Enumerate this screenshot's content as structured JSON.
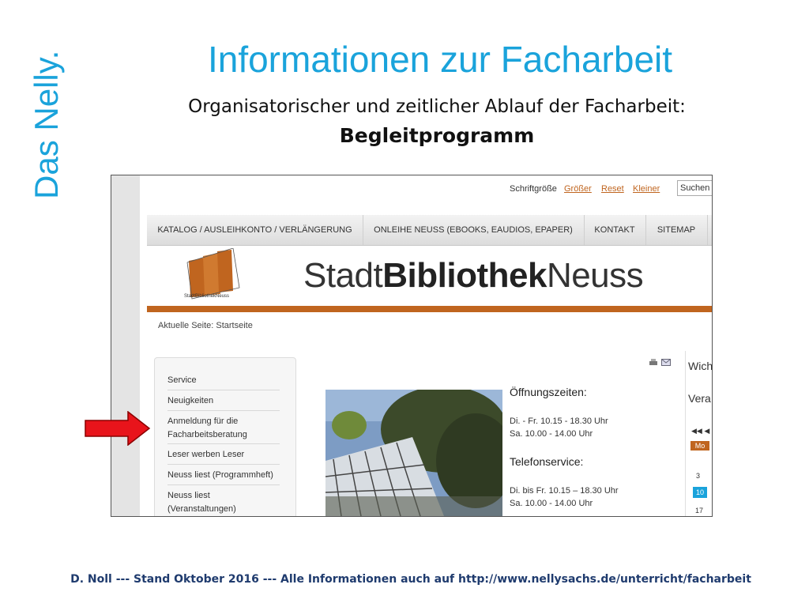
{
  "slide": {
    "side_title": "Das Nelly.",
    "title": "Informationen zur Facharbeit",
    "subtitle": "Organisatorischer und zeitlicher Ablauf der Facharbeit:",
    "subtitle_bold": "Begleitprogramm",
    "footer": "D. Noll --- Stand Oktober 2016 --- Alle Informationen auch auf http://www.nellysachs.de/unterricht/facharbeit"
  },
  "site": {
    "font_size_label": "Schriftgröße",
    "font_links": [
      "Größer",
      "Reset",
      "Kleiner"
    ],
    "search_placeholder": "Suchen",
    "nav": [
      "KATALOG / AUSLEIHKONTO / VERLÄNGERUNG",
      "ONLEIHE NEUSS (EBOOKS, EAUDIOS, EPAPER)",
      "KONTAKT",
      "SITEMAP"
    ],
    "brand_light": "Stadt",
    "brand_bold": "Bibliothek",
    "brand_end": "Neuss",
    "logo_caption": "StadtBibliothekNeuss",
    "breadcrumb": "Aktuelle Seite: Startseite",
    "menu": [
      "Service",
      "Neuigkeiten",
      "Anmeldung für die Facharbeitsberatung",
      "Leser werben Leser",
      "Neuss liest (Programmheft)",
      "Neuss liest (Veranstaltungen)"
    ],
    "hours_title": "Öffnungszeiten:",
    "hours": [
      "Di. - Fr. 10.15 - 18.30 Uhr",
      "Sa. 10.00 - 14.00 Uhr"
    ],
    "phone_title": "Telefonservice:",
    "phone": [
      "Di. bis Fr. 10.15 – 18.30 Uhr",
      "Sa. 10.00 - 14.00 Uhr"
    ],
    "right_titles": [
      "Wich",
      "Vera"
    ],
    "calendar": {
      "nav": "◀◀ ◀",
      "day": "Mo",
      "dates": [
        "3",
        "10",
        "17"
      ]
    }
  },
  "colors": {
    "accent_blue": "#1aa3db",
    "site_orange": "#c0651f",
    "arrow_red": "#e8141b"
  }
}
